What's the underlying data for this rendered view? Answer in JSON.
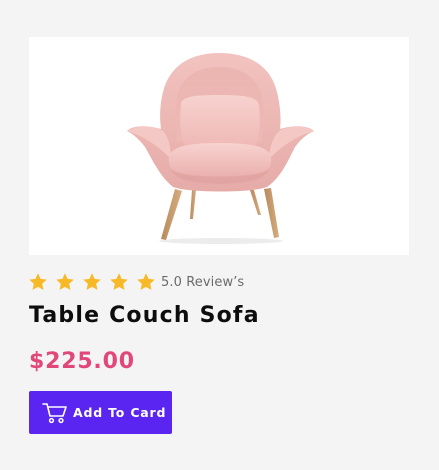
{
  "product": {
    "image_name": "pink-armchair-image",
    "rating": 5,
    "rating_max": 5,
    "review_text": "5.0 Review’s",
    "title": "Table Couch Sofa",
    "price": "$225.00",
    "add_button_label": "Add To Card",
    "add_button_icon": "cart-icon"
  },
  "colors": {
    "background": "#f4f4f4",
    "image_background": "#ffffff",
    "star": "#f7b928",
    "price": "#e2477a",
    "button": "#5a25f0",
    "button_text": "#ffffff",
    "title": "#0d0d0d",
    "review_text": "#6b6b6b"
  }
}
